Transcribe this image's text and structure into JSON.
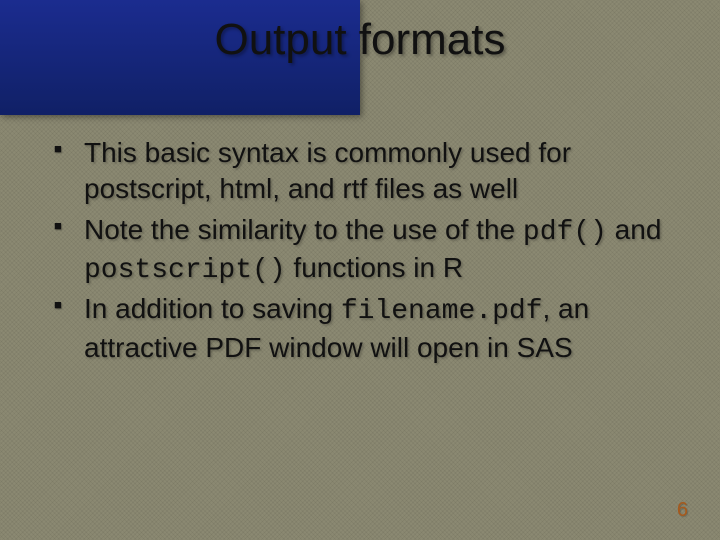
{
  "title": "Output formats",
  "bullets": [
    {
      "pre": "This basic syntax is commonly used for postscript, html, and rtf files as well",
      "code1": "",
      "mid": "",
      "code2": "",
      "post": ""
    },
    {
      "pre": "Note the similarity to the use of the ",
      "code1": "pdf()",
      "mid": " and ",
      "code2": "postscript()",
      "post": " functions in R"
    },
    {
      "pre": "In addition to saving ",
      "code1": "filename.pdf",
      "mid": ", an attractive PDF window will open in SAS",
      "code2": "",
      "post": ""
    }
  ],
  "page_number": "6"
}
